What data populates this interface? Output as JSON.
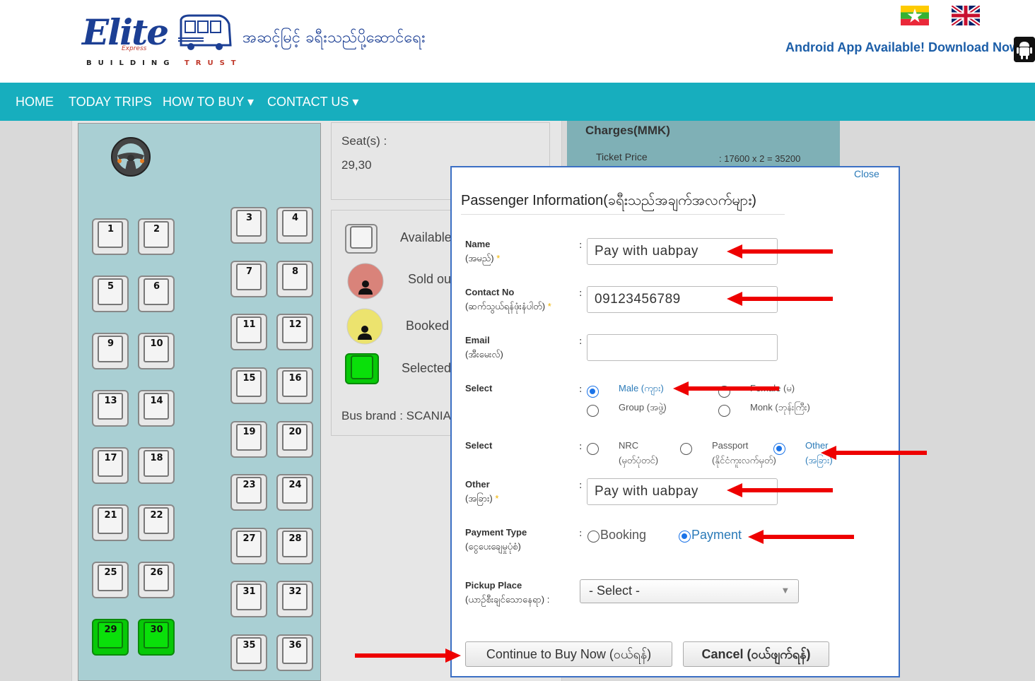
{
  "header": {
    "logo_text": "Elite",
    "logo_sub": "Express",
    "logo_tag_1": "BUILDING",
    "logo_tag_2": "TRUST",
    "site_title": "အဆင့်မြင့် ခရီးသည်ပို့ဆောင်ရေး",
    "android_text": "Android App Available! Download Now."
  },
  "nav": {
    "items": [
      "HOME",
      "TODAY TRIPS",
      "HOW TO BUY ▾",
      "CONTACT US ▾"
    ]
  },
  "seat_map": {
    "seats": [
      "1",
      "2",
      "3",
      "4",
      "5",
      "6",
      "7",
      "8",
      "9",
      "10",
      "11",
      "12",
      "13",
      "14",
      "15",
      "16",
      "17",
      "18",
      "19",
      "20",
      "21",
      "22",
      "23",
      "24",
      "25",
      "26",
      "27",
      "28",
      "29",
      "30",
      "31",
      "32",
      "35",
      "36"
    ],
    "selected": [
      "29",
      "30"
    ],
    "selected_color": "#07c907"
  },
  "booking_info": {
    "seats_label": "Seat(s) :",
    "seats_value": "29,30",
    "legend": [
      "Available",
      "Sold ou",
      "Booked",
      "Selected"
    ],
    "bus_brand": "Bus brand : SCANIA"
  },
  "charges": {
    "title": "Charges(MMK)",
    "ticket_label": "Ticket Price",
    "ticket_value": ": 17600 x 2 = 35200"
  },
  "modal": {
    "close": "Close",
    "title": "Passenger Information(ခရီးသည်အချက်အလက်များ)",
    "name_label": "Name",
    "name_label_mm": "(အမည်)",
    "name_value": "Pay with uabpay",
    "contact_label": "Contact No",
    "contact_label_mm": "(ဆက်သွယ်ရန်ဖုံးနံပါတ်)",
    "contact_value": "09123456789",
    "email_label": "Email",
    "email_label_mm": "(အီးမေးလ်)",
    "email_value": "",
    "select_label": "Select",
    "gender_options": [
      "Male (ကျား)",
      "Female (မ)",
      "Group (အဖွဲ့)",
      "Monk (ဘုန်းကြီး)"
    ],
    "select2_label": "Select",
    "id_options": [
      {
        "line1": "NRC",
        "line2": "(မှတ်ပုံတင်)"
      },
      {
        "line1": "Passport",
        "line2": "(နိုင်ငံကူးလက်မှတ်)"
      },
      {
        "line1": "Other",
        "line2": "(အခြား)"
      }
    ],
    "other_label": "Other",
    "other_label_mm": "(အခြား)",
    "other_value": "Pay with uabpay",
    "payment_label": "Payment Type",
    "payment_label_mm": "(ငွေပေးချေမှုပုံစံ)",
    "payment_options": [
      "Booking",
      "Payment"
    ],
    "pickup_label": "Pickup Place",
    "pickup_label_mm": "(ယာဉ်စီးချင်သောနေရာ) :",
    "pickup_value": "- Select -",
    "continue_button": "Continue to Buy Now (ဝယ်ရန်)",
    "cancel_button": "Cancel (ဝယ်ဖျက်ရန်)",
    "required_mark": "*"
  },
  "colors": {
    "nav_bg": "#17aebe",
    "brand_blue": "#1c3f94",
    "arrow_red": "#e00000"
  }
}
